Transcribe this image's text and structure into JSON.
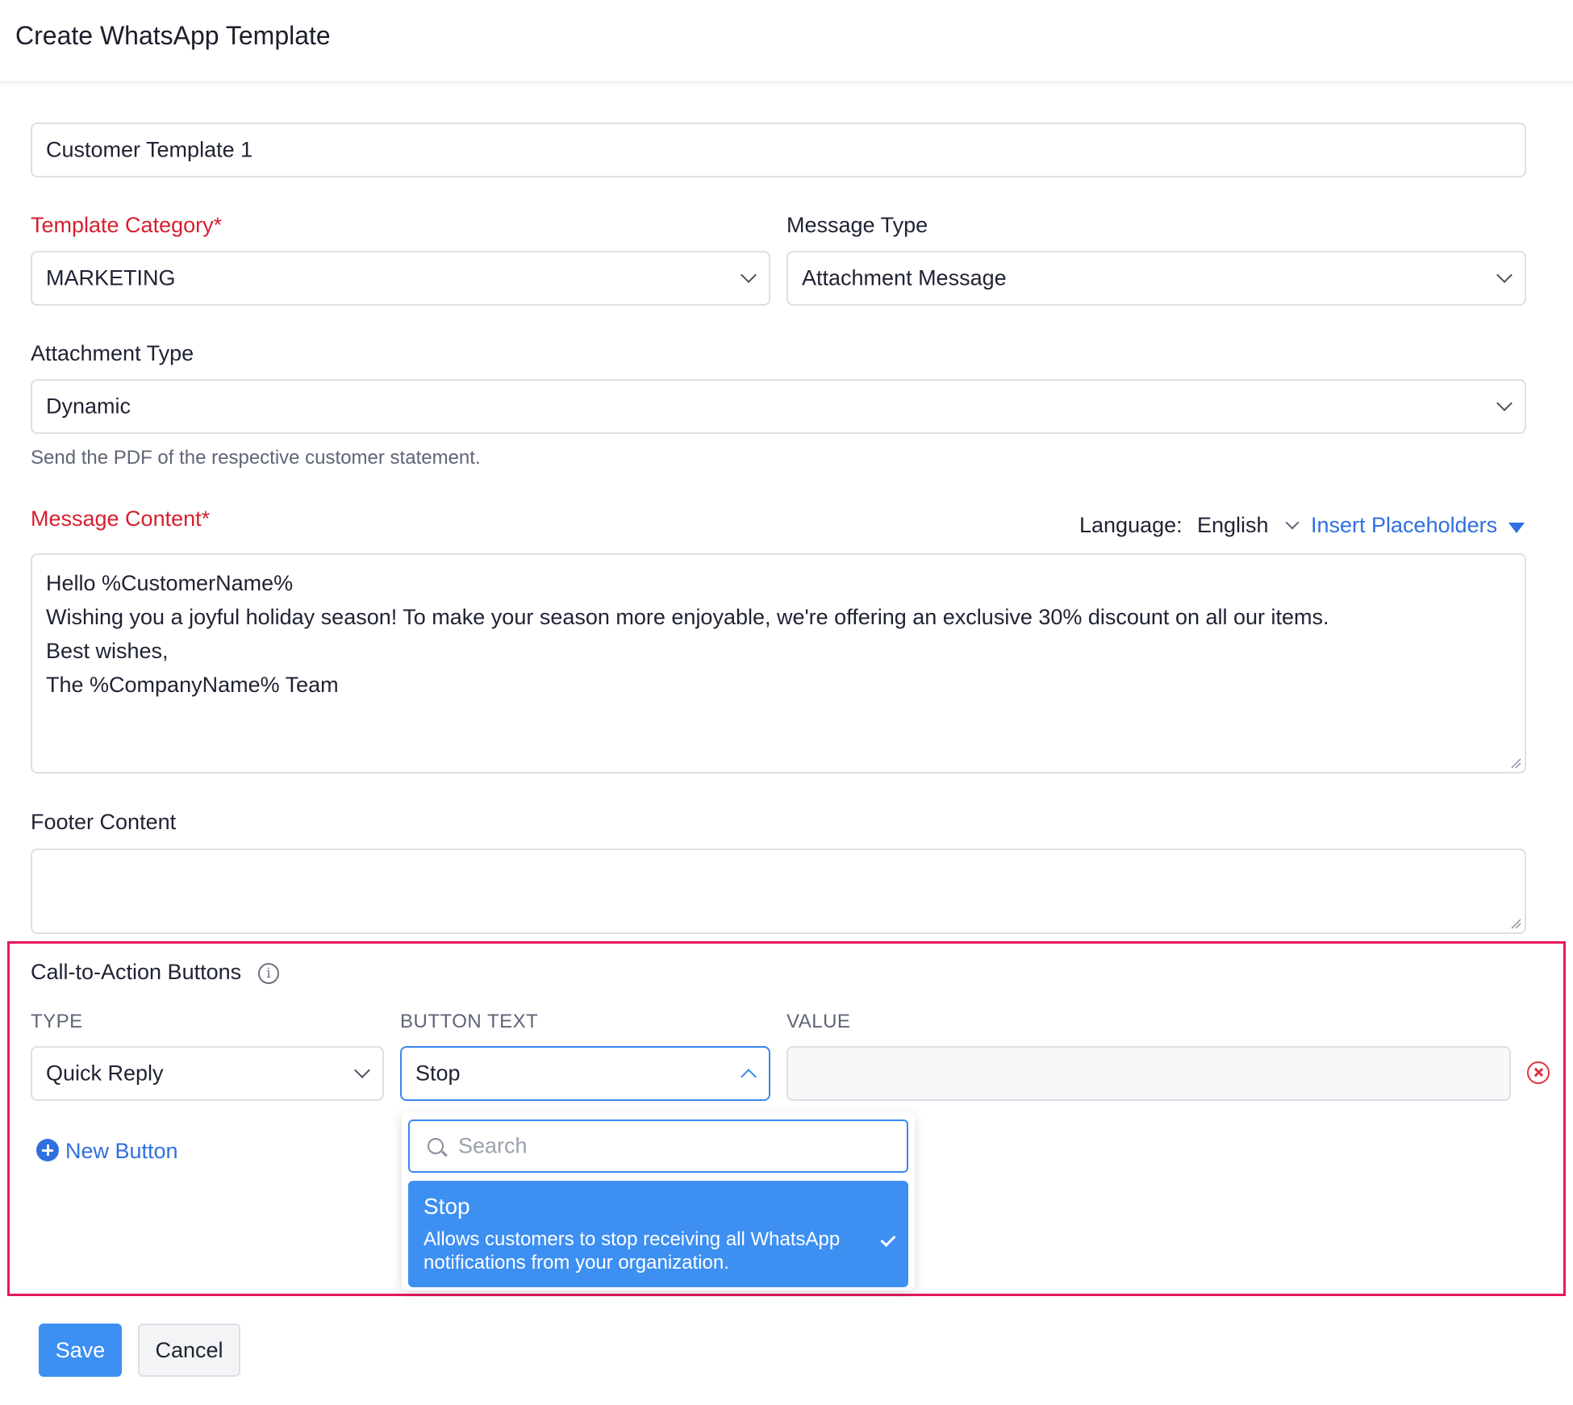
{
  "header": {
    "title": "Create WhatsApp Template"
  },
  "form": {
    "template_name": {
      "value": "Customer Template 1"
    },
    "template_category": {
      "label": "Template Category*",
      "value": "MARKETING"
    },
    "message_type": {
      "label": "Message Type",
      "value": "Attachment Message"
    },
    "attachment_type": {
      "label": "Attachment Type",
      "value": "Dynamic",
      "hint": "Send the PDF of the respective customer statement."
    },
    "message_content": {
      "label": "Message Content*",
      "language_label": "Language:",
      "language_value": "English",
      "insert_placeholders": "Insert Placeholders",
      "lines": [
        "Hello %CustomerName%",
        "Wishing you a joyful holiday season! To make your season more enjoyable, we're offering an exclusive 30% discount on all our items.",
        "Best wishes,",
        "The %CompanyName% Team"
      ]
    },
    "footer_content": {
      "label": "Footer Content",
      "value": ""
    }
  },
  "cta": {
    "title": "Call-to-Action Buttons",
    "columns": {
      "type": "TYPE",
      "button_text": "BUTTON TEXT",
      "value": "VALUE"
    },
    "row": {
      "type": "Quick Reply",
      "button_text": "Stop",
      "value": ""
    },
    "new_button": "New Button",
    "dropdown": {
      "search_placeholder": "Search",
      "option": {
        "title": "Stop",
        "description": "Allows customers to stop receiving all WhatsApp notifications from your organization."
      }
    }
  },
  "actions": {
    "save": "Save",
    "cancel": "Cancel"
  },
  "colors": {
    "accent": "#3d8ff2",
    "required": "#d5202f",
    "highlight_border": "#e8175d",
    "remove": "#e0323f"
  }
}
